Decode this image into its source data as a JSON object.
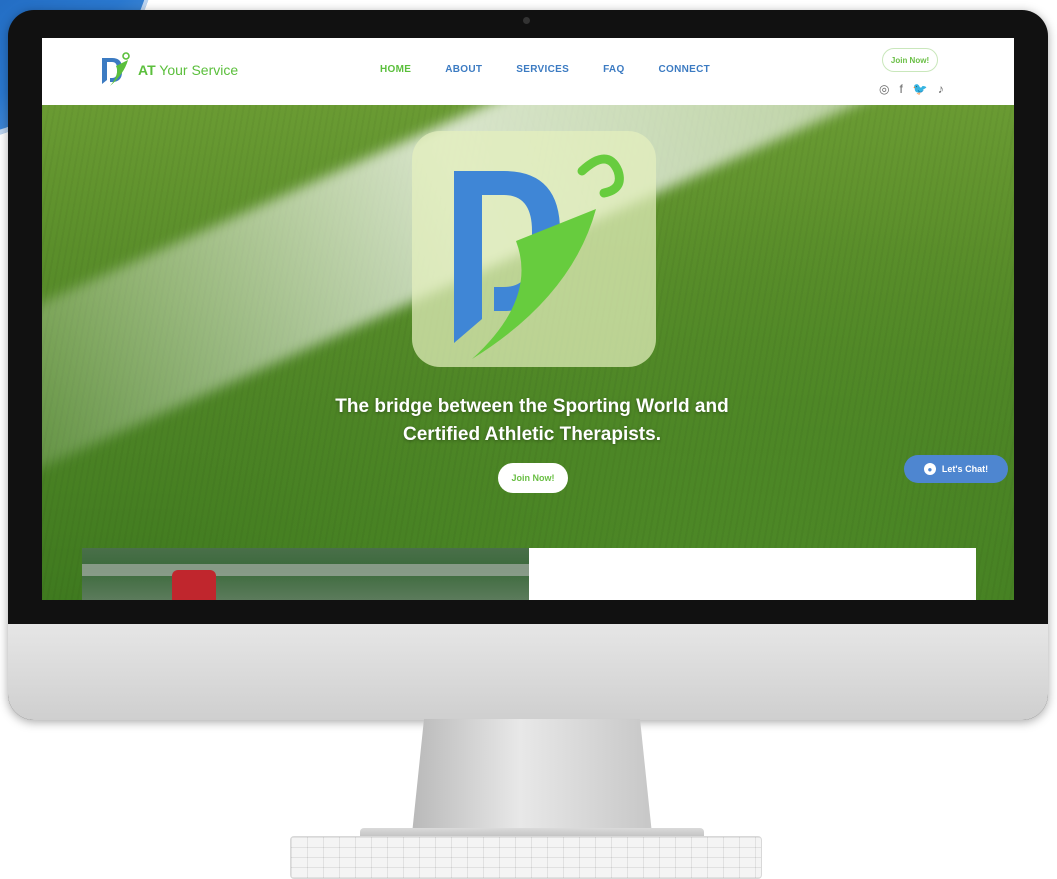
{
  "brand": {
    "name_prefix": "AT",
    "name_suffix": " Your Service"
  },
  "nav": {
    "items": [
      {
        "label": "HOME",
        "active": true
      },
      {
        "label": "ABOUT",
        "active": false
      },
      {
        "label": "SERVICES",
        "active": false
      },
      {
        "label": "FAQ",
        "active": false
      },
      {
        "label": "CONNECT",
        "active": false
      }
    ]
  },
  "header": {
    "join_label": "Join Now!"
  },
  "socials": [
    {
      "icon": "instagram-icon",
      "glyph": "◎"
    },
    {
      "icon": "facebook-icon",
      "glyph": "f"
    },
    {
      "icon": "twitter-icon",
      "glyph": "🐦"
    },
    {
      "icon": "tiktok-icon",
      "glyph": "♪"
    }
  ],
  "hero": {
    "headline_line1": "The bridge between the Sporting World and",
    "headline_line2": "Certified Athletic Therapists.",
    "join_label": "Join Now!"
  },
  "chat": {
    "label": "Let's Chat!"
  },
  "colors": {
    "brand_blue": "#3c7bc2",
    "brand_green": "#5bbf3c",
    "chat_blue": "#4e86d0"
  }
}
